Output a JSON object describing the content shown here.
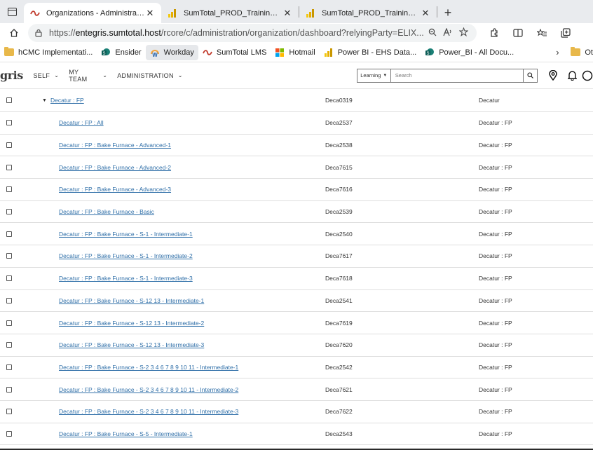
{
  "browser": {
    "tabs": [
      {
        "title": "Organizations - Administration -",
        "active": true
      },
      {
        "title": "SumTotal_PROD_Training_Metric",
        "active": false
      },
      {
        "title": "SumTotal_PROD_Training_Metric",
        "active": false
      }
    ],
    "close_glyph": "✕",
    "newtab_glyph": "+",
    "url_prefix": "https://",
    "url_host": "entegris.sumtotal.host",
    "url_rest": "/rcore/c/administration/organization/dashboard?relyingParty=ELIX...",
    "bookmarks": [
      {
        "label": "hCMC Implementati...",
        "icon": "folder-icon"
      },
      {
        "label": "Ensider",
        "icon": "sharepoint-icon"
      },
      {
        "label": "Workday",
        "icon": "workday-icon"
      },
      {
        "label": "SumTotal LMS",
        "icon": "sumtotal-icon"
      },
      {
        "label": "Hotmail",
        "icon": "microsoft-icon"
      },
      {
        "label": "Power BI - EHS Data...",
        "icon": "powerbi-icon"
      },
      {
        "label": "Power_BI - All Docu...",
        "icon": "sharepoint-icon"
      },
      {
        "label": "Ot",
        "icon": "folder-icon"
      }
    ],
    "colors": {
      "accent_link": "#2f6fa8",
      "tab_strip": "#e9ebee"
    }
  },
  "app": {
    "logo": "gris",
    "nav": [
      {
        "label": "SELF"
      },
      {
        "label": "MY TEAM"
      },
      {
        "label": "ADMINISTRATION"
      }
    ],
    "search": {
      "scope": "Learning",
      "placeholder": "Search"
    }
  },
  "table": {
    "rows": [
      {
        "name": "Decatur : FP",
        "code": "Deca0319",
        "parent": "Decatur",
        "level": 0,
        "expanded": true
      },
      {
        "name": "Decatur : FP : All",
        "code": "Deca2537",
        "parent": "Decatur : FP",
        "level": 1
      },
      {
        "name": "Decatur : FP : Bake Furnace - Advanced-1",
        "code": "Deca2538",
        "parent": "Decatur : FP",
        "level": 1
      },
      {
        "name": "Decatur : FP : Bake Furnace - Advanced-2",
        "code": "Deca7615",
        "parent": "Decatur : FP",
        "level": 1
      },
      {
        "name": "Decatur : FP : Bake Furnace - Advanced-3",
        "code": "Deca7616",
        "parent": "Decatur : FP",
        "level": 1
      },
      {
        "name": "Decatur : FP : Bake Furnace - Basic",
        "code": "Deca2539",
        "parent": "Decatur : FP",
        "level": 1
      },
      {
        "name": "Decatur : FP : Bake Furnace - S-1 - Intermediate-1",
        "code": "Deca2540",
        "parent": "Decatur : FP",
        "level": 1
      },
      {
        "name": "Decatur : FP : Bake Furnace - S-1 - Intermediate-2",
        "code": "Deca7617",
        "parent": "Decatur : FP",
        "level": 1
      },
      {
        "name": "Decatur : FP : Bake Furnace - S-1 - Intermediate-3",
        "code": "Deca7618",
        "parent": "Decatur : FP",
        "level": 1
      },
      {
        "name": "Decatur : FP : Bake Furnace - S-12 13 - Intermediate-1",
        "code": "Deca2541",
        "parent": "Decatur : FP",
        "level": 1
      },
      {
        "name": "Decatur : FP : Bake Furnace - S-12 13 - Intermediate-2",
        "code": "Deca7619",
        "parent": "Decatur : FP",
        "level": 1
      },
      {
        "name": "Decatur : FP : Bake Furnace - S-12 13 - Intermediate-3",
        "code": "Deca7620",
        "parent": "Decatur : FP",
        "level": 1
      },
      {
        "name": "Decatur : FP : Bake Furnace - S-2 3 4 6 7 8 9 10 11 - Intermediate-1",
        "code": "Deca2542",
        "parent": "Decatur : FP",
        "level": 1
      },
      {
        "name": "Decatur : FP : Bake Furnace - S-2 3 4 6 7 8 9 10 11 - Intermediate-2",
        "code": "Deca7621",
        "parent": "Decatur : FP",
        "level": 1
      },
      {
        "name": "Decatur : FP : Bake Furnace - S-2 3 4 6 7 8 9 10 11 - Intermediate-3",
        "code": "Deca7622",
        "parent": "Decatur : FP",
        "level": 1
      },
      {
        "name": "Decatur : FP : Bake Furnace - S-5 - Intermediate-1",
        "code": "Deca2543",
        "parent": "Decatur : FP",
        "level": 1
      }
    ]
  }
}
